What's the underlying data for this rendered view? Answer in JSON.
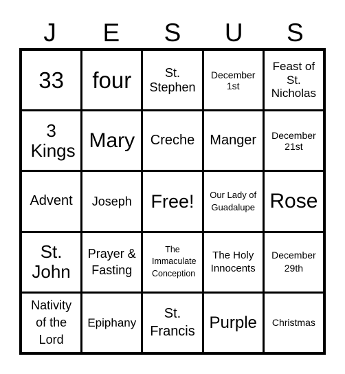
{
  "title_letters": [
    "J",
    "E",
    "S",
    "U",
    "S"
  ],
  "board": {
    "rows": [
      [
        "33",
        "four",
        "St. Stephen",
        "December 1st",
        "Feast of St. Nicholas"
      ],
      [
        "3 Kings",
        "Mary",
        "Creche",
        "Manger",
        "December 21st"
      ],
      [
        "Advent",
        "Joseph",
        "Free!",
        "Our Lady of Guadalupe",
        "Rose"
      ],
      [
        "St. John",
        "Prayer & Fasting",
        "The Immaculate Conception",
        "The Holy Innocents",
        "December 29th"
      ],
      [
        "Nativity of the Lord",
        "Epiphany",
        "St. Francis",
        "Purple",
        "Christmas"
      ]
    ]
  },
  "colors": {
    "line": "#000000",
    "cell_bg": "#ffffff",
    "text": "#000000"
  }
}
